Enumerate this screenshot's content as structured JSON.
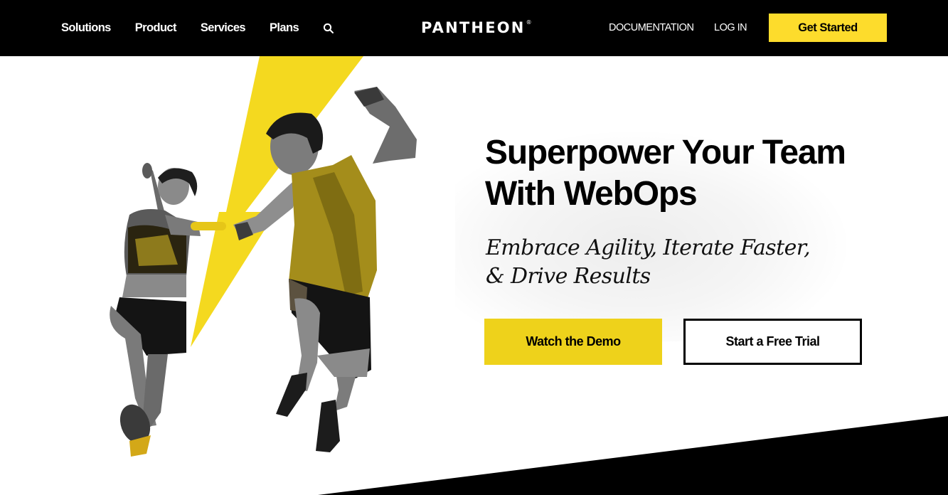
{
  "header": {
    "nav_links": [
      {
        "label": "Solutions"
      },
      {
        "label": "Product"
      },
      {
        "label": "Services"
      },
      {
        "label": "Plans"
      }
    ],
    "search_icon": "search-icon",
    "logo": {
      "text": "PANTHEON",
      "mark": "®"
    },
    "documentation_label": "DOCUMENTATION",
    "login_label": "LOG IN",
    "cta_label": "Get Started"
  },
  "hero": {
    "headline": "Superpower Your Team With WebOps",
    "subhead_line1": "Embrace Agility, Iterate Faster,",
    "subhead_line2": "& Drive Results",
    "primary_button": "Watch the Demo",
    "secondary_button": "Start a Free Trial",
    "image_description": "Two relay runners passing a yellow baton in front of a yellow lightning bolt"
  },
  "colors": {
    "header_bg": "#000000",
    "brand_yellow": "#fddc2c",
    "button_yellow": "#eed21b",
    "bolt_yellow": "#f4d91f",
    "text": "#000000",
    "background": "#ffffff"
  }
}
